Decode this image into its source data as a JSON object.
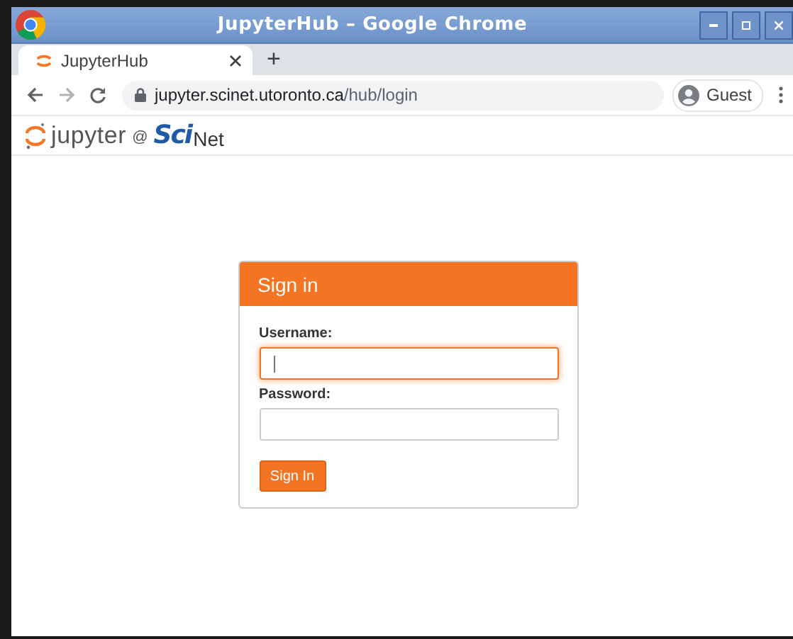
{
  "window": {
    "title": "JupyterHub – Google Chrome"
  },
  "tabs": [
    {
      "label": "JupyterHub",
      "selected": true
    }
  ],
  "new_tab": "+",
  "toolbar": {
    "back_disabled": false,
    "forward_disabled": true,
    "url": {
      "host": "jupyter.scinet.utoronto.ca",
      "path": "/hub/login"
    },
    "profile": "Guest"
  },
  "site_header": {
    "logo": {
      "name": "jupyter",
      "at": "@",
      "org_a": "Sci",
      "org_b": "Net"
    }
  },
  "login": {
    "title": "Sign in",
    "fields": [
      {
        "label": "Username:",
        "focused": true
      },
      {
        "label": "Password:",
        "focused": false
      }
    ],
    "submit": "Sign In"
  }
}
